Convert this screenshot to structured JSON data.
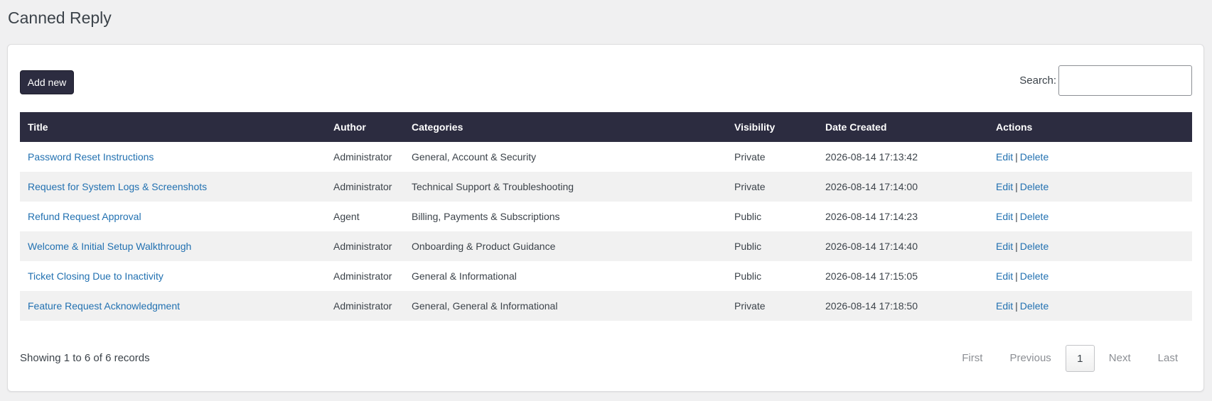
{
  "page": {
    "title": "Canned Reply"
  },
  "toolbar": {
    "add_label": "Add new",
    "search_label": "Search:",
    "search_value": ""
  },
  "table": {
    "columns": [
      "Title",
      "Author",
      "Categories",
      "Visibility",
      "Date Created",
      "Actions"
    ],
    "rows": [
      {
        "title": "Password Reset Instructions",
        "author": "Administrator",
        "categories": "General, Account & Security",
        "visibility": "Private",
        "date": "2026-08-14 17:13:42"
      },
      {
        "title": "Request for System Logs & Screenshots",
        "author": "Administrator",
        "categories": "Technical Support & Troubleshooting",
        "visibility": "Private",
        "date": "2026-08-14 17:14:00"
      },
      {
        "title": "Refund Request Approval",
        "author": "Agent",
        "categories": "Billing, Payments & Subscriptions",
        "visibility": "Public",
        "date": "2026-08-14 17:14:23"
      },
      {
        "title": "Welcome & Initial Setup Walkthrough",
        "author": "Administrator",
        "categories": "Onboarding & Product Guidance",
        "visibility": "Public",
        "date": "2026-08-14 17:14:40"
      },
      {
        "title": "Ticket Closing Due to Inactivity",
        "author": "Administrator",
        "categories": "General & Informational",
        "visibility": "Public",
        "date": "2026-08-14 17:15:05"
      },
      {
        "title": "Feature Request Acknowledgment",
        "author": "Administrator",
        "categories": "General, General & Informational",
        "visibility": "Private",
        "date": "2026-08-14 17:18:50"
      }
    ],
    "actions": {
      "edit_label": "Edit",
      "separator": "|",
      "delete_label": "Delete"
    }
  },
  "footer": {
    "info": "Showing 1 to 6 of 6 records",
    "pagination": {
      "first": "First",
      "previous": "Previous",
      "current": "1",
      "next": "Next",
      "last": "Last"
    }
  },
  "colors": {
    "header_bg": "#2c2c40",
    "link": "#2271b1",
    "page_bg": "#f0f0f1"
  }
}
